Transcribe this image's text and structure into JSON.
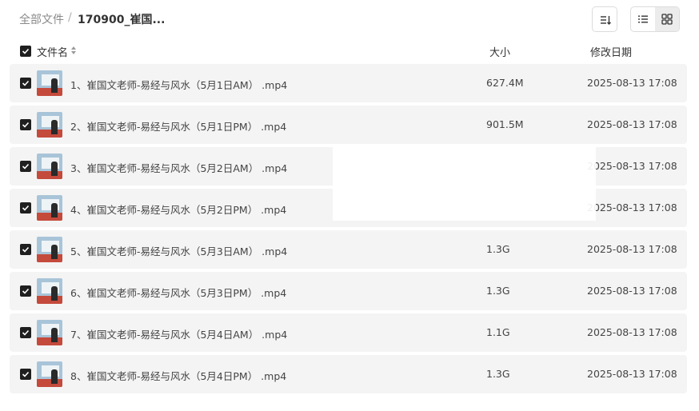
{
  "breadcrumb": {
    "root": "全部文件",
    "separator": "/",
    "current": "170900_崔国..."
  },
  "toolbar": {
    "sort_icon": "sort-icon",
    "list_view_icon": "list-view-icon",
    "grid_view_icon": "grid-view-icon"
  },
  "table": {
    "columns": {
      "name": "文件名",
      "size": "大小",
      "modified": "修改日期"
    },
    "rows": [
      {
        "name": "1、崔国文老师-易经与风水（5月1日AM） .mp4",
        "size": "627.4M",
        "date": "2025-08-13 17:08"
      },
      {
        "name": "2、崔国文老师-易经与风水（5月1日PM） .mp4",
        "size": "901.5M",
        "date": "2025-08-13 17:08"
      },
      {
        "name": "3、崔国文老师-易经与风水（5月2日AM） .mp4",
        "size": "",
        "date": "2025-08-13 17:08"
      },
      {
        "name": "4、崔国文老师-易经与风水（5月2日PM） .mp4",
        "size": "",
        "date": "2025-08-13 17:08"
      },
      {
        "name": "5、崔国文老师-易经与风水（5月3日AM） .mp4",
        "size": "1.3G",
        "date": "2025-08-13 17:08"
      },
      {
        "name": "6、崔国文老师-易经与风水（5月3日PM） .mp4",
        "size": "1.3G",
        "date": "2025-08-13 17:08"
      },
      {
        "name": "7、崔国文老师-易经与风水（5月4日AM） .mp4",
        "size": "1.1G",
        "date": "2025-08-13 17:08"
      },
      {
        "name": "8、崔国文老师-易经与风水（5月4日PM） .mp4",
        "size": "1.3G",
        "date": "2025-08-13 17:08"
      }
    ]
  },
  "colors": {
    "row_background": "#f4f4f4",
    "checkbox": "#1f1f1f",
    "text": "#444444",
    "breadcrumb_muted": "#8a8a8a"
  }
}
